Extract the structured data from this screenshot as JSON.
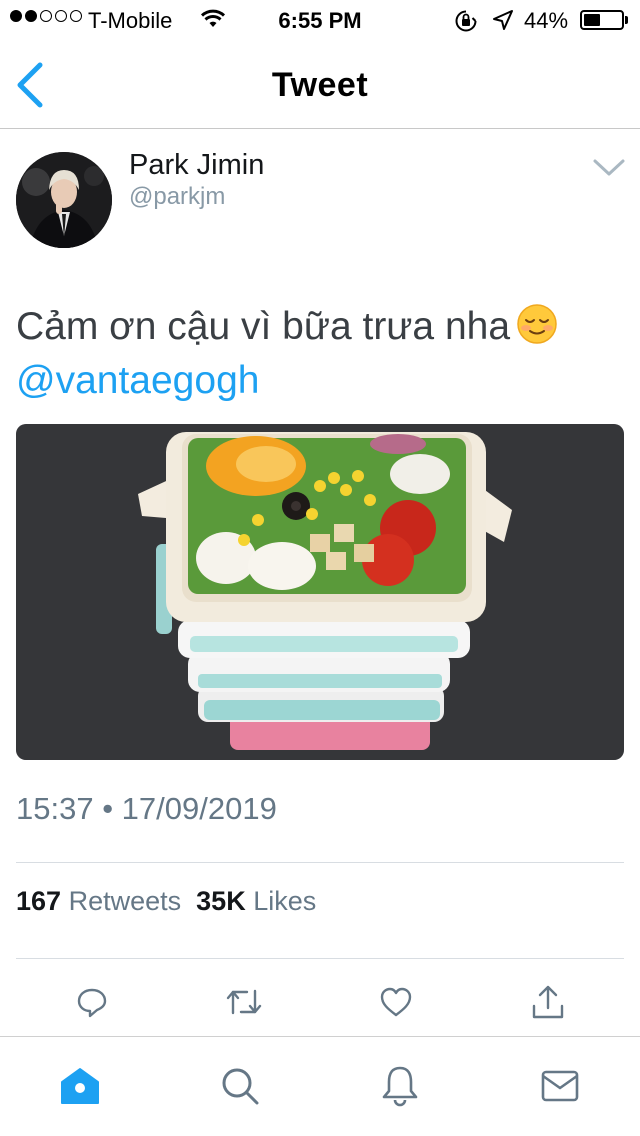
{
  "status_bar": {
    "carrier": "T-Mobile",
    "signal_bars_filled": 2,
    "signal_bars_total": 5,
    "time": "6:55 PM",
    "battery_percent": "44%",
    "battery_level": 0.44
  },
  "nav": {
    "back_icon": "chevron-left-icon",
    "title": "Tweet"
  },
  "tweet": {
    "author_name": "Park Jimin",
    "author_handle": "@parkjm",
    "text": "Cảm ơn cậu vì bữa trưa nha",
    "emoji_icon": "smiling-face-emoji",
    "mention": "@vantaegogh",
    "timestamp": "15:37 • 17/09/2019",
    "retweet_count": "167",
    "retweet_label": "Retweets",
    "like_count": "35K",
    "like_label": "Likes"
  },
  "actions": [
    "reply-icon",
    "retweet-icon",
    "like-icon",
    "share-icon"
  ],
  "tab_bar": [
    "home-icon",
    "search-icon",
    "notifications-icon",
    "messages-icon"
  ],
  "colors": {
    "accent": "#1da1f2",
    "icon_gray": "#657786",
    "text_dark": "#14171a"
  }
}
